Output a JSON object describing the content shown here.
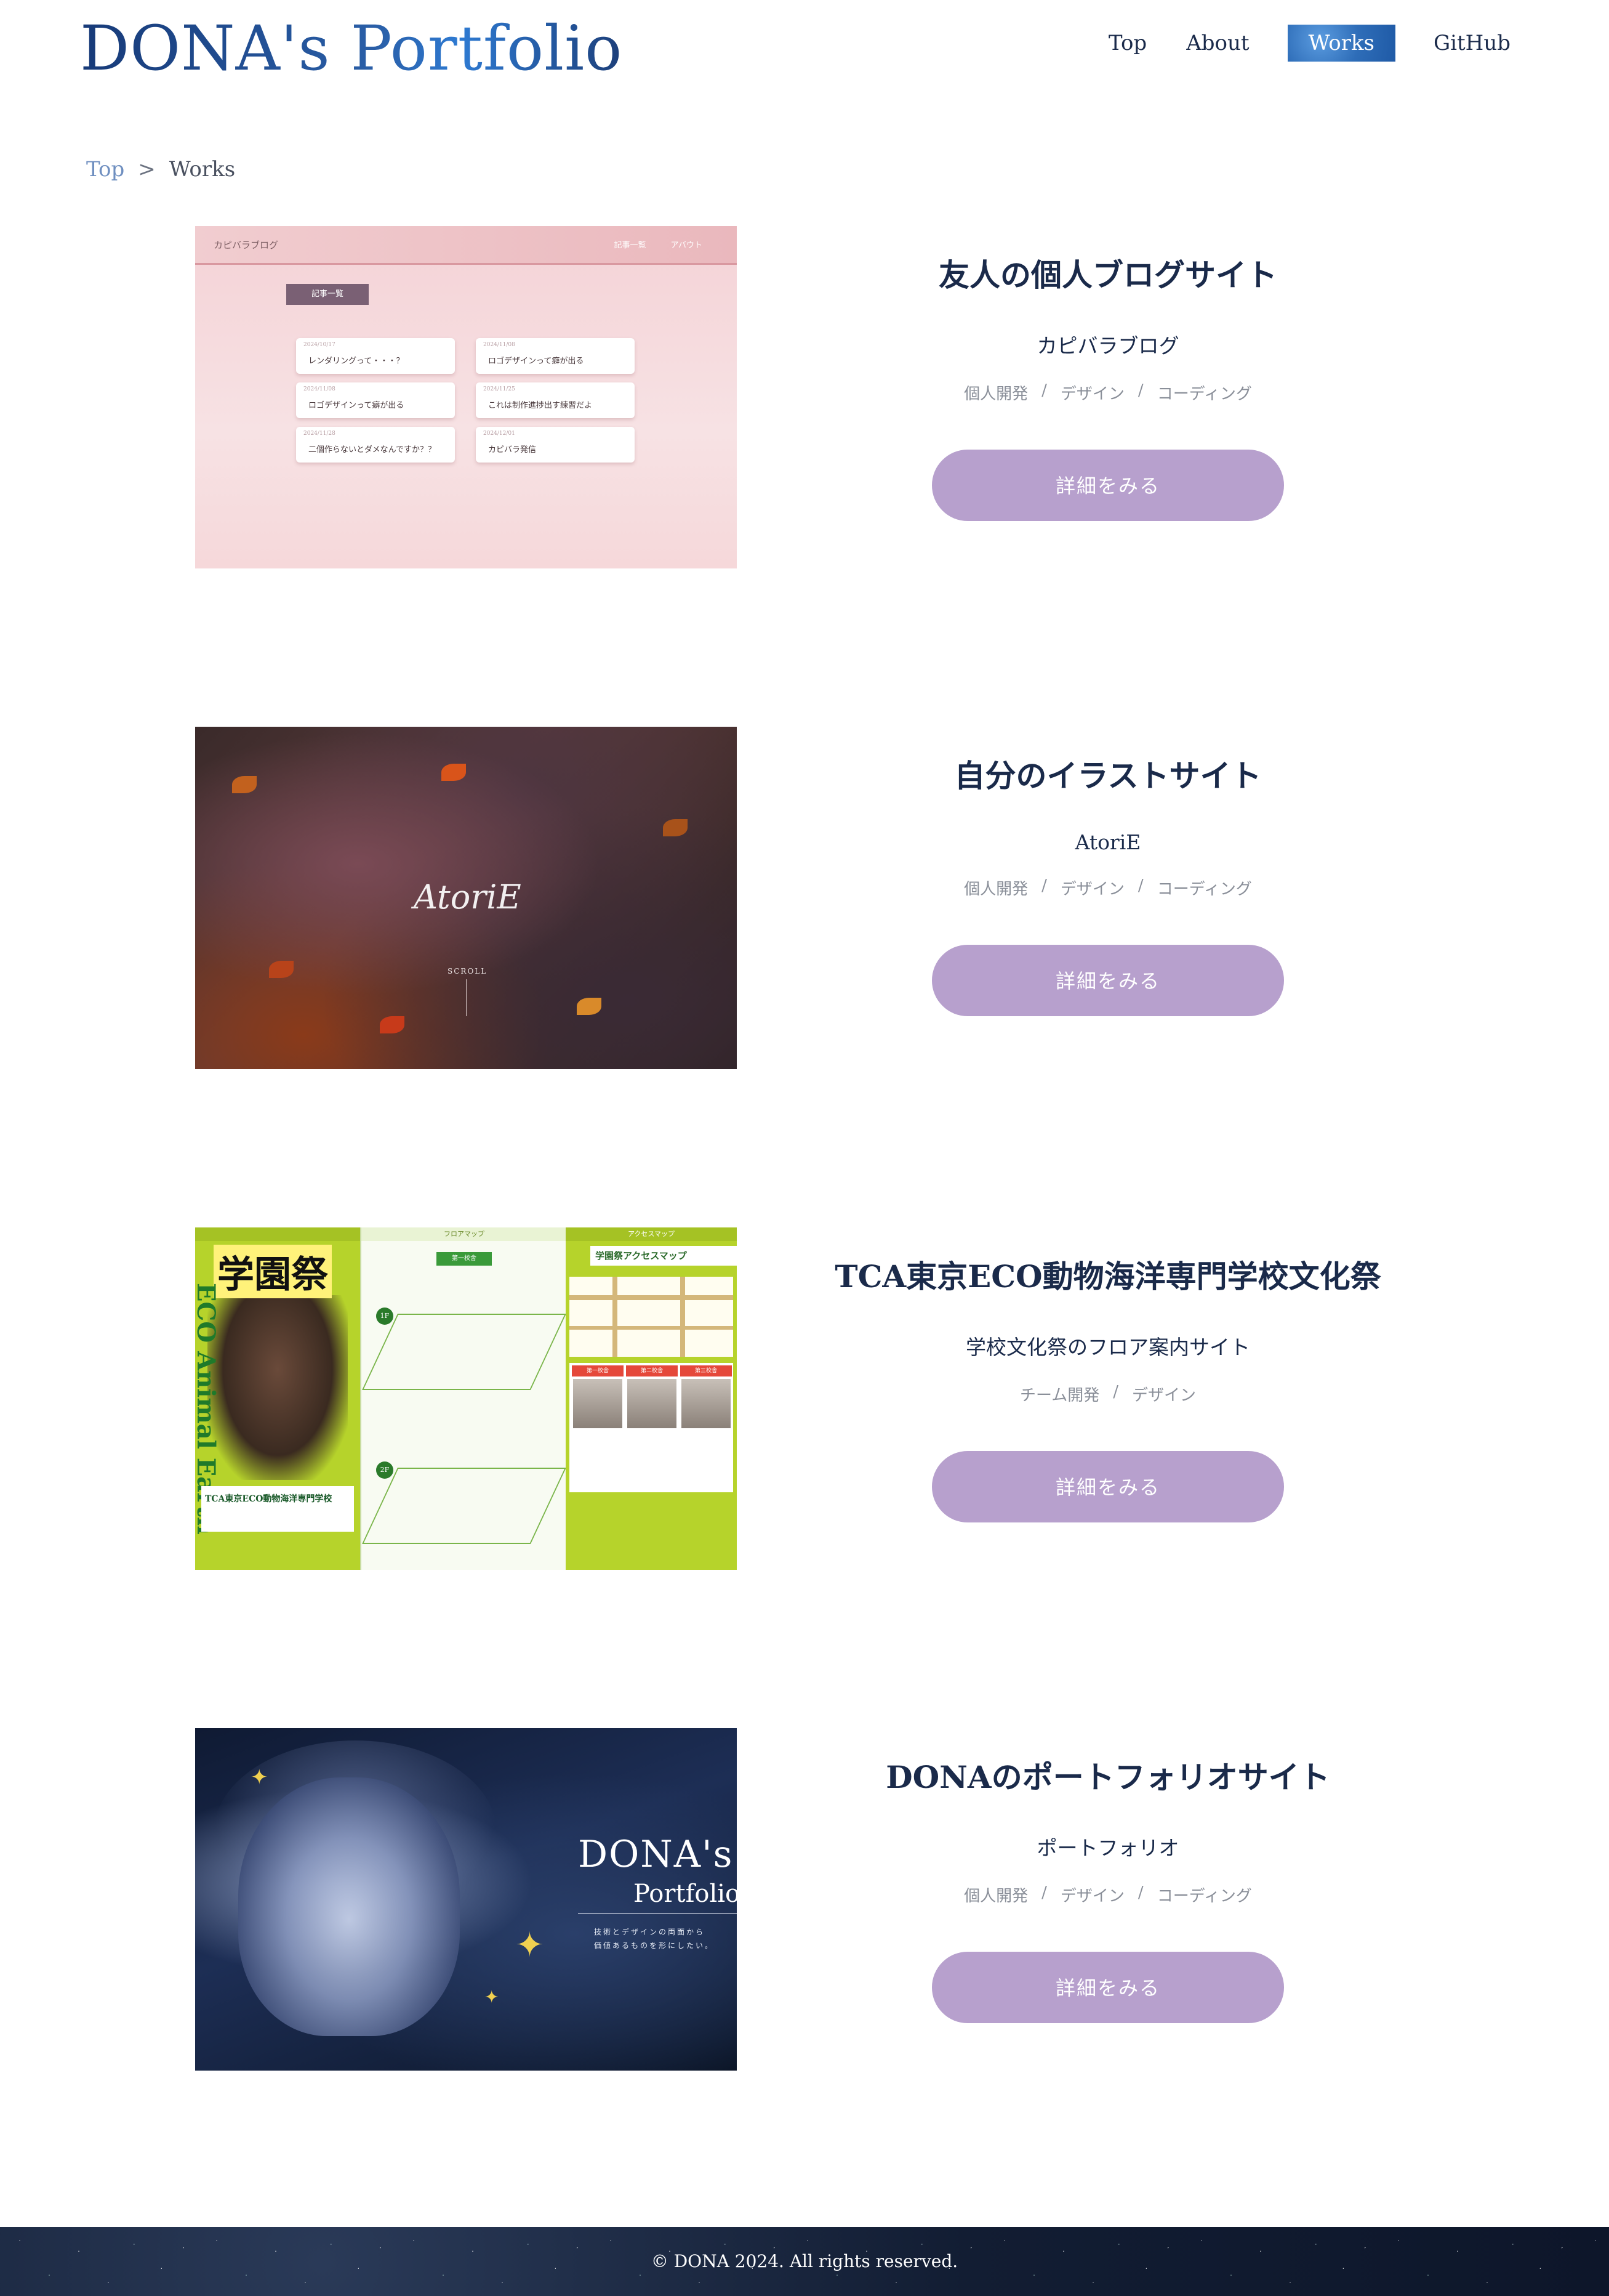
{
  "header": {
    "logo": "DONA's Portfolio",
    "nav": [
      {
        "label": "Top",
        "active": false
      },
      {
        "label": "About",
        "active": false
      },
      {
        "label": "Works",
        "active": true
      },
      {
        "label": "GitHub",
        "active": false
      }
    ]
  },
  "breadcrumb": {
    "home": "Top",
    "separator": ">",
    "current": "Works"
  },
  "works": [
    {
      "title": "友人の個人ブログサイト",
      "subtitle": "カピバラブログ",
      "tags": [
        "個人開発",
        "デザイン",
        "コーディング"
      ],
      "button": "詳細をみる",
      "thumb": {
        "logo": "カピバラブログ",
        "nav": [
          "記事一覧",
          "アバウト"
        ],
        "heading": "記事一覧",
        "cards": [
          {
            "date": "2024/10/17",
            "title": "レンダリングって・・・？"
          },
          {
            "date": "2024/11/08",
            "title": "ロゴデザインって癖が出る"
          },
          {
            "date": "2024/11/08",
            "title": "ロゴデザインって癖が出る"
          },
          {
            "date": "2024/11/25",
            "title": "これは制作進捗出す練習だよ"
          },
          {
            "date": "2024/11/28",
            "title": "二個作らないとダメなんですか？？"
          },
          {
            "date": "2024/12/01",
            "title": "カピバラ発信"
          }
        ]
      }
    },
    {
      "title": "自分のイラストサイト",
      "subtitle": "AtoriE",
      "tags": [
        "個人開発",
        "デザイン",
        "コーディング"
      ],
      "button": "詳細をみる",
      "thumb": {
        "signature": "AtoriE",
        "scroll": "SCROLL"
      }
    },
    {
      "title": "TCA東京ECO動物海洋専門学校文化祭",
      "subtitle": "学校文化祭のフロア案内サイト",
      "tags": [
        "チーム開発",
        "デザイン"
      ],
      "button": "詳細をみる",
      "thumb": {
        "festival": "学園祭",
        "eco": "ECO Animal Earth",
        "school": "TCA東京ECO動物海洋専門学校",
        "floor_header": "フロアマップ",
        "first_floor": "第一校舎",
        "floors": [
          "1F",
          "2F"
        ],
        "access_header": "アクセスマップ",
        "map_title": "学園祭アクセスマップ",
        "photo_labels": [
          "第一校舎",
          "第二校舎",
          "第三校舎"
        ]
      }
    },
    {
      "title": "DONAのポートフォリオサイト",
      "subtitle": "ポートフォリオ",
      "tags": [
        "個人開発",
        "デザイン",
        "コーディング"
      ],
      "button": "詳細をみる",
      "thumb": {
        "title1": "DONA's",
        "title2": "Portfolio",
        "line1": "技術とデザインの両面から",
        "line2": "価値あるものを形にしたい。"
      }
    }
  ],
  "footer": {
    "copyright": "© DONA 2024. All rights reserved."
  }
}
